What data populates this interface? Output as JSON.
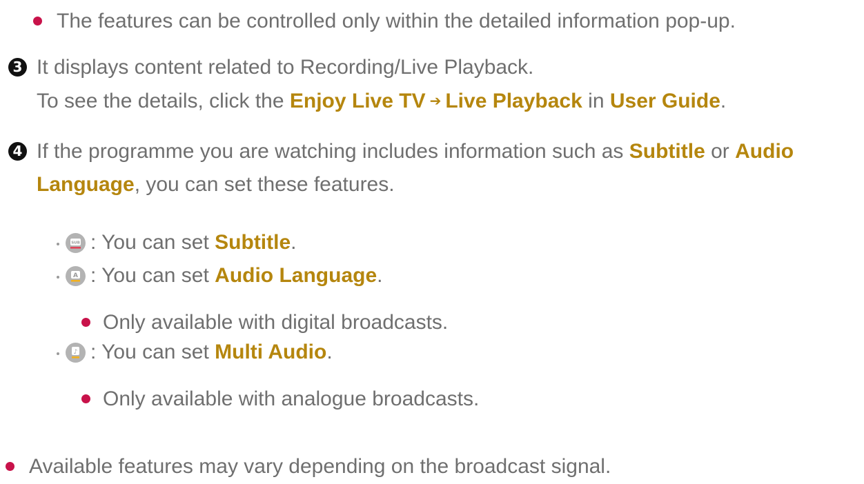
{
  "note_top": "The features can be controlled only within the detailed information pop-up.",
  "item3": {
    "number": "3",
    "line1": "It displays content related to Recording/Live Playback.",
    "line2_prefix": "To see the details, click the ",
    "link1": "Enjoy Live TV",
    "arrow": "➔",
    "link2": "Live Playback",
    "mid": " in ",
    "link3": "User Guide",
    "end": "."
  },
  "item4": {
    "number": "4",
    "line1_prefix": "If the programme you are watching includes information such as ",
    "subtitle": "Subtitle",
    "or": " or ",
    "audio": "Audio",
    "language": "Language",
    "line2_rest": ", you can set these features."
  },
  "features": [
    {
      "icon": "subtitle-icon",
      "icon_text": "SUB",
      "prefix": ": You can set ",
      "label": "Subtitle",
      "end": "."
    },
    {
      "icon": "audio-language-icon",
      "icon_text": "A",
      "prefix": ": You can set ",
      "label": "Audio Language",
      "end": ".",
      "note": "Only available with digital broadcasts."
    },
    {
      "icon": "multi-audio-icon",
      "icon_text": "♪",
      "prefix": ": You can set ",
      "label": "Multi Audio",
      "end": ".",
      "note": "Only available with analogue broadcasts."
    }
  ],
  "note_bottom": "Available features may vary depending on the broadcast signal.",
  "colors": {
    "text": "#6f6f6f",
    "highlight": "#b5860e",
    "bullet": "#c8124a",
    "number_badge": "#111111"
  }
}
